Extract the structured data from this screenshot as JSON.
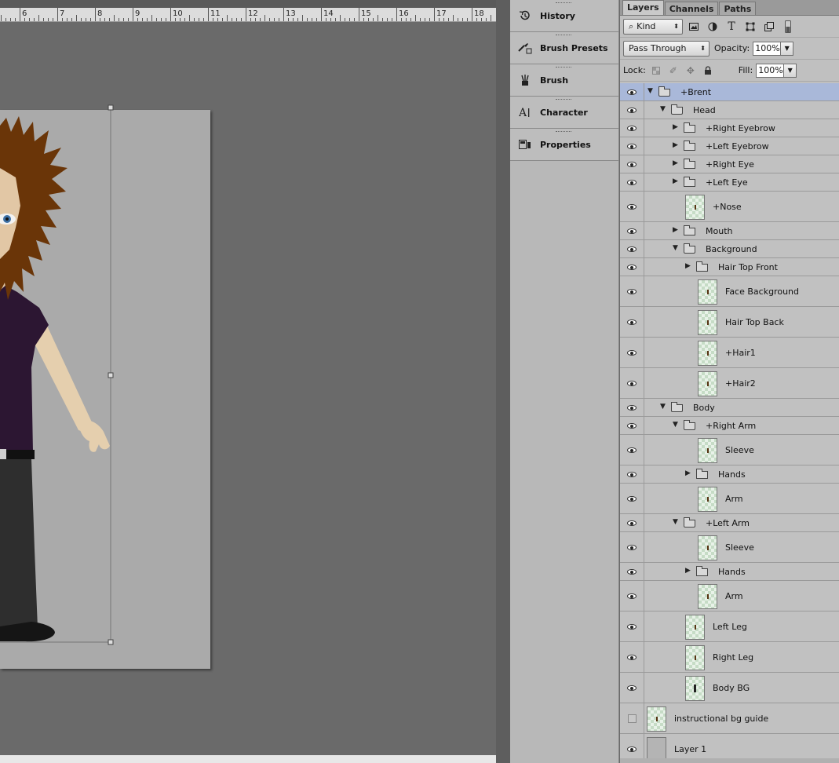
{
  "ruler": {
    "numbers": [
      "6",
      "7",
      "8",
      "9",
      "10",
      "11",
      "12",
      "13",
      "14",
      "15",
      "16",
      "17",
      "18"
    ]
  },
  "dock": {
    "items": [
      {
        "label": "History",
        "icon": "history-icon"
      },
      {
        "label": "Brush Presets",
        "icon": "brush-presets-icon"
      },
      {
        "label": "Brush",
        "icon": "brush-icon"
      },
      {
        "label": "Character",
        "icon": "character-icon"
      },
      {
        "label": "Properties",
        "icon": "properties-icon"
      }
    ]
  },
  "panel": {
    "tabs": [
      "Layers",
      "Channels",
      "Paths"
    ],
    "active_tab": "Layers",
    "filter_kind": "Kind",
    "blend_mode": "Pass Through",
    "opacity_label": "Opacity:",
    "opacity_value": "100%",
    "lock_label": "Lock:",
    "fill_label": "Fill:",
    "fill_value": "100%"
  },
  "layers": [
    {
      "name": "+Brent",
      "type": "group",
      "open": true,
      "depth": 0,
      "selected": true,
      "visible": true
    },
    {
      "name": "Head",
      "type": "group",
      "open": true,
      "depth": 1,
      "visible": true
    },
    {
      "name": "+Right Eyebrow",
      "type": "group",
      "open": false,
      "depth": 2,
      "visible": true
    },
    {
      "name": "+Left Eyebrow",
      "type": "group",
      "open": false,
      "depth": 2,
      "visible": true
    },
    {
      "name": "+Right Eye",
      "type": "group",
      "open": false,
      "depth": 2,
      "visible": true
    },
    {
      "name": "+Left Eye",
      "type": "group",
      "open": false,
      "depth": 2,
      "visible": true
    },
    {
      "name": "+Nose",
      "type": "layer",
      "depth": 2,
      "visible": true
    },
    {
      "name": "Mouth",
      "type": "group",
      "open": false,
      "depth": 2,
      "visible": true
    },
    {
      "name": "Background",
      "type": "group",
      "open": true,
      "depth": 2,
      "visible": true
    },
    {
      "name": "Hair Top Front",
      "type": "group",
      "open": false,
      "depth": 3,
      "visible": true
    },
    {
      "name": "Face Background",
      "type": "layer",
      "depth": 3,
      "visible": true
    },
    {
      "name": "Hair Top Back",
      "type": "layer",
      "depth": 3,
      "visible": true
    },
    {
      "name": "+Hair1",
      "type": "layer",
      "depth": 3,
      "visible": true
    },
    {
      "name": "+Hair2",
      "type": "layer",
      "depth": 3,
      "visible": true
    },
    {
      "name": "Body",
      "type": "group",
      "open": true,
      "depth": 1,
      "visible": true
    },
    {
      "name": "+Right Arm",
      "type": "group",
      "open": true,
      "depth": 2,
      "visible": true
    },
    {
      "name": "Sleeve",
      "type": "layer",
      "depth": 3,
      "visible": true
    },
    {
      "name": "Hands",
      "type": "group",
      "open": false,
      "depth": 3,
      "visible": true
    },
    {
      "name": "Arm",
      "type": "layer",
      "depth": 3,
      "visible": true
    },
    {
      "name": "+Left Arm",
      "type": "group",
      "open": true,
      "depth": 2,
      "visible": true
    },
    {
      "name": "Sleeve",
      "type": "layer",
      "depth": 3,
      "visible": true
    },
    {
      "name": "Hands",
      "type": "group",
      "open": false,
      "depth": 3,
      "visible": true
    },
    {
      "name": "Arm",
      "type": "layer",
      "depth": 3,
      "visible": true
    },
    {
      "name": "Left Leg",
      "type": "layer",
      "depth": 2,
      "visible": true
    },
    {
      "name": "Right Leg",
      "type": "layer",
      "depth": 2,
      "visible": true
    },
    {
      "name": "Body BG",
      "type": "layer",
      "depth": 2,
      "visible": true
    },
    {
      "name": "instructional bg guide",
      "type": "layer",
      "depth": 0,
      "visible": false
    },
    {
      "name": "Layer 1",
      "type": "layer",
      "depth": 0,
      "visible": true,
      "gray": true
    }
  ]
}
